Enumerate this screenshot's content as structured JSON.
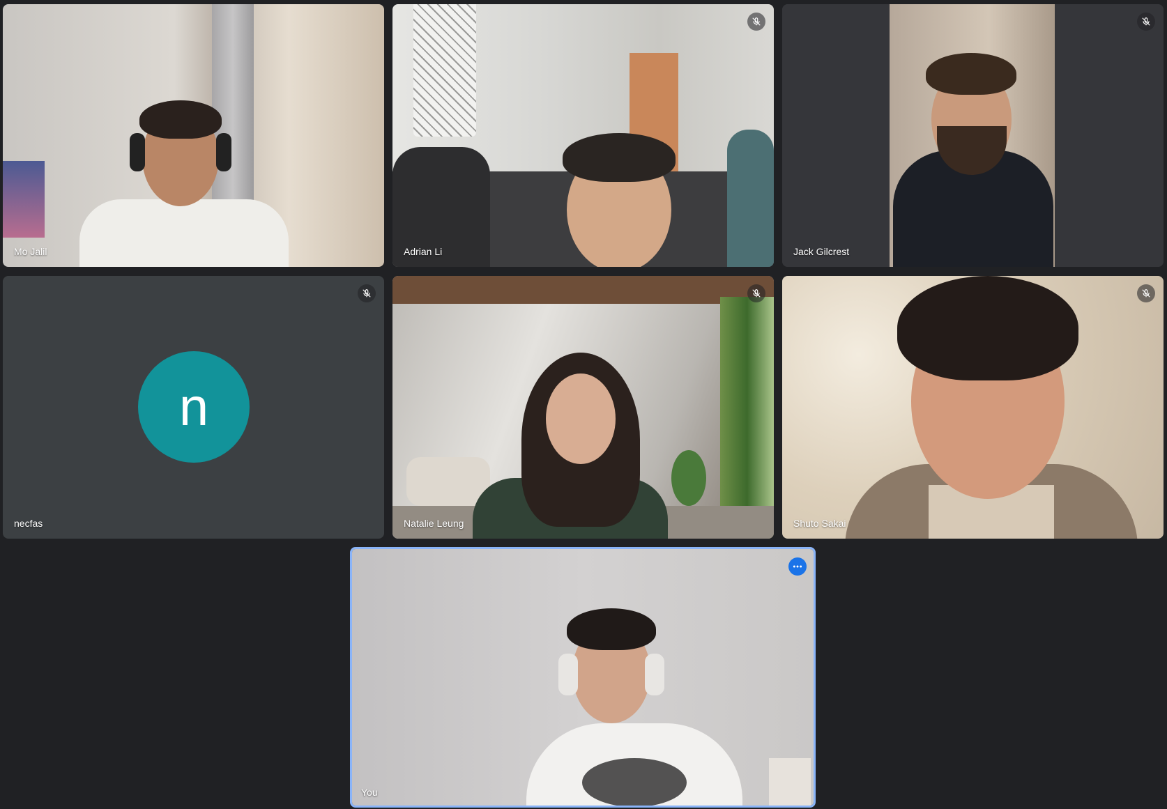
{
  "participants": [
    {
      "name": "Mo Jalil",
      "muted": false
    },
    {
      "name": "Adrian Li",
      "muted": true
    },
    {
      "name": "Jack Gilcrest",
      "muted": true
    },
    {
      "name": "necfas",
      "muted": true,
      "avatar_letter": "n",
      "avatar_color": "#12939a"
    },
    {
      "name": "Natalie Leung",
      "muted": true
    },
    {
      "name": "Shuto Sakai",
      "muted": true
    },
    {
      "name": "You",
      "muted": false,
      "highlighted": true,
      "menu_icon": "more-horiz-icon"
    }
  ],
  "colors": {
    "background": "#202124",
    "tile": "#3c4043",
    "self_border": "#8ab4f8",
    "accent": "#1a73e8"
  },
  "icons": {
    "mute": "mic-off-icon",
    "more": "more-horiz-icon"
  }
}
